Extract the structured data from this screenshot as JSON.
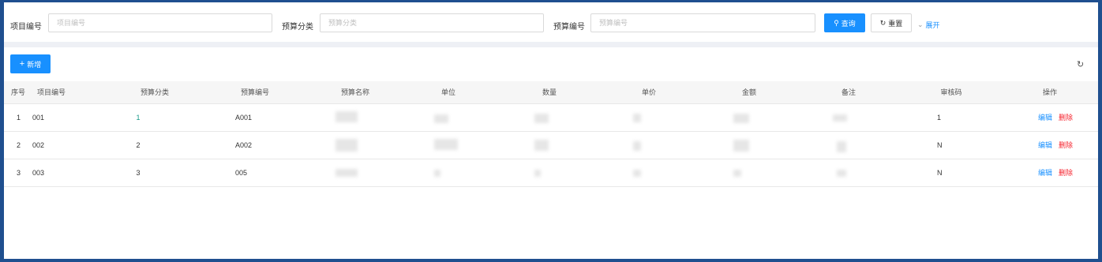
{
  "search": {
    "project_no_label": "项目编号",
    "project_no_placeholder": "项目编号",
    "category_label": "预算分类",
    "category_placeholder": "预算分类",
    "budget_no_label": "预算编号",
    "budget_no_placeholder": "预算编号",
    "query_label": "查询",
    "reset_label": "重置",
    "expand_label": "展开"
  },
  "toolbar": {
    "add_label": "新增"
  },
  "table": {
    "headers": {
      "index": "序号",
      "project_no": "项目编号",
      "category": "预算分类",
      "budget_no": "预算编号",
      "name": "预算名称",
      "unit": "单位",
      "quantity": "数量",
      "unit_price": "单价",
      "amount": "金额",
      "remark": "备注",
      "audit": "审核码",
      "actions": "操作"
    },
    "rows": [
      {
        "index": "1",
        "project_no": "001",
        "category": "1",
        "budget_no": "A001",
        "audit": "1",
        "edit": "编辑",
        "delete": "删除"
      },
      {
        "index": "2",
        "project_no": "002",
        "category": "2",
        "budget_no": "A002",
        "audit": "N",
        "edit": "编辑",
        "delete": "删除"
      },
      {
        "index": "3",
        "project_no": "003",
        "category": "3",
        "budget_no": "005",
        "audit": "N",
        "edit": "编辑",
        "delete": "删除"
      }
    ]
  },
  "colors": {
    "primary": "#1890ff",
    "danger": "#f5222d",
    "frame": "#1f4f8f"
  }
}
